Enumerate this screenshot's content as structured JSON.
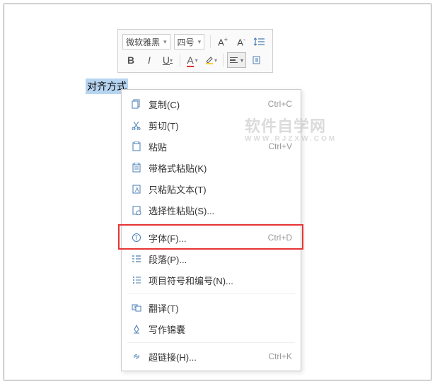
{
  "toolbar": {
    "font_name": "微软雅黑",
    "font_size": "四号",
    "increase_label": "A",
    "decrease_label": "A",
    "bold": "B",
    "italic": "I",
    "underline": "U",
    "strike": "A"
  },
  "selection": {
    "text": "对齐方式"
  },
  "context_menu": {
    "items": [
      {
        "icon": "copy",
        "label": "复制(C)",
        "shortcut": "Ctrl+C"
      },
      {
        "icon": "cut",
        "label": "剪切(T)",
        "shortcut": ""
      },
      {
        "icon": "paste",
        "label": "粘贴",
        "shortcut": ""
      },
      {
        "icon": "paste-format",
        "label": "带格式粘贴(K)",
        "shortcut": ""
      },
      {
        "icon": "paste-text",
        "label": "只粘贴文本(T)",
        "shortcut": ""
      },
      {
        "icon": "paste-special",
        "label": "选择性粘贴(S)...",
        "shortcut": ""
      },
      {
        "icon": "font",
        "label": "字体(F)...",
        "shortcut": "Ctrl+D"
      },
      {
        "icon": "paragraph",
        "label": "段落(P)...",
        "shortcut": ""
      },
      {
        "icon": "bullets",
        "label": "项目符号和编号(N)...",
        "shortcut": ""
      },
      {
        "icon": "translate",
        "label": "翻译(T)",
        "shortcut": ""
      },
      {
        "icon": "writing",
        "label": "写作锦囊",
        "shortcut": ""
      },
      {
        "icon": "link",
        "label": "超链接(H)...",
        "shortcut": "Ctrl+K"
      }
    ]
  },
  "watermark": {
    "line1": "软件自学网",
    "line2": "WWW.RJZXW.COM"
  }
}
